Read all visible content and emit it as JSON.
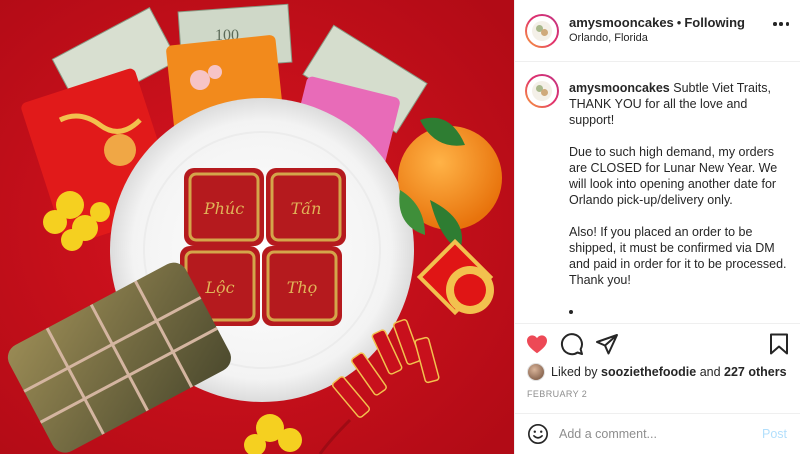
{
  "post": {
    "image_alt": "Mooncakes on a white plate with red envelopes, money, oranges and firecrackers",
    "mooncakes": [
      "Phúc",
      "Tấn",
      "Lộc",
      "Thọ"
    ]
  },
  "header": {
    "username": "amysmooncakes",
    "separator": "•",
    "follow_status": "Following",
    "location": "Orlando, Florida",
    "more_icon": "more-horizontal-icon"
  },
  "caption": {
    "username": "amysmooncakes",
    "text": "Subtle Viet Traits, THANK YOU for all the love and support!\n\nDue to such high demand, my orders are CLOSED for Lunar New Year. We will look into opening another date for Orlando pick-up/delivery only.\n\nAlso! If you placed an order to be shipped, it must be confirmed via DM and paid in order for it to be processed. Thank you!"
  },
  "actions": {
    "like_icon": "heart-filled-icon",
    "comment_icon": "comment-icon",
    "share_icon": "share-icon",
    "save_icon": "bookmark-icon",
    "like_color": "#ed4956"
  },
  "likes": {
    "prefix": "Liked by",
    "user": "sooziethefoodie",
    "and": "and",
    "others": "227 others"
  },
  "date": "FEBRUARY 2",
  "comment": {
    "placeholder": "Add a comment...",
    "post_label": "Post",
    "emoji_icon": "smile-icon"
  },
  "colors": {
    "accent_disabled": "#b2dffc",
    "text": "#262626",
    "muted": "#8e8e8e",
    "photo_background": "#c8101c"
  }
}
